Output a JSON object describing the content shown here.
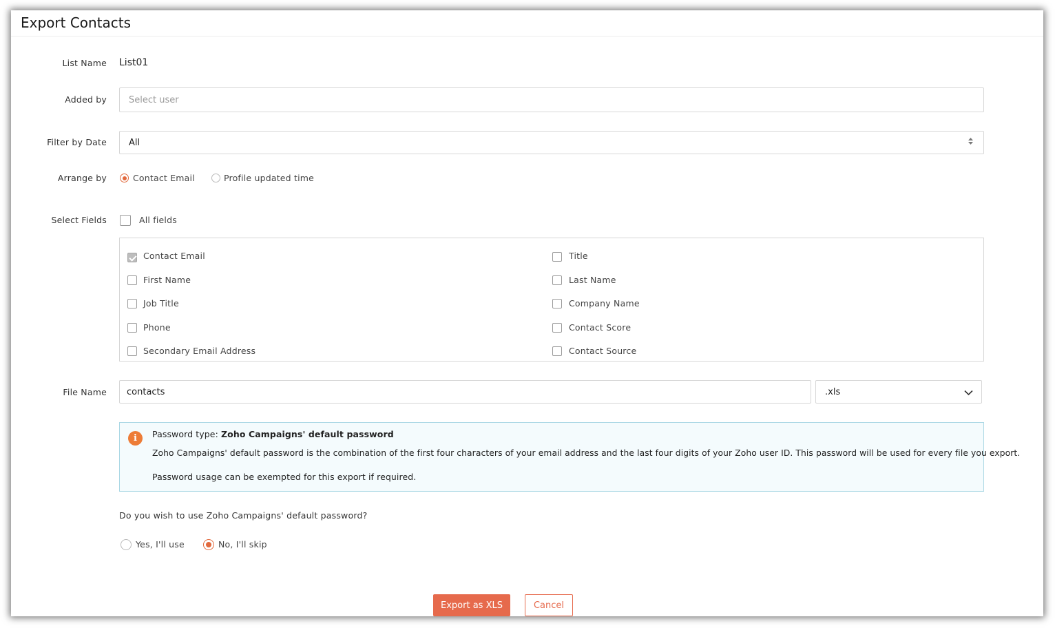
{
  "dialog": {
    "title": "Export Contacts"
  },
  "list_name": {
    "label": "List Name",
    "value": "List01"
  },
  "added_by": {
    "label": "Added by",
    "placeholder": "Select user"
  },
  "filter_by_date": {
    "label": "Filter by Date",
    "value": "All"
  },
  "arrange_by": {
    "label": "Arrange by",
    "options": [
      {
        "label": "Contact Email",
        "selected": true
      },
      {
        "label": "Profile updated time",
        "selected": false
      }
    ]
  },
  "select_fields": {
    "label": "Select Fields",
    "all_fields_label": "All fields",
    "fields": [
      {
        "label": "Contact Email",
        "checked": true
      },
      {
        "label": "Title",
        "checked": false
      },
      {
        "label": "First Name",
        "checked": false
      },
      {
        "label": "Last Name",
        "checked": false
      },
      {
        "label": "Job Title",
        "checked": false
      },
      {
        "label": "Company Name",
        "checked": false
      },
      {
        "label": "Phone",
        "checked": false
      },
      {
        "label": "Contact Score",
        "checked": false
      },
      {
        "label": "Secondary Email Address",
        "checked": false
      },
      {
        "label": "Contact Source",
        "checked": false
      }
    ]
  },
  "file_name": {
    "label": "File Name",
    "value": "contacts",
    "extension": ".xls"
  },
  "info": {
    "type_label": "Password type:",
    "type_value": "Zoho Campaigns' default password",
    "description": "Zoho Campaigns' default password is the combination of the first four characters of your email address and the last four digits of your Zoho user ID. This password will be used for every file you export.",
    "exemption": "Password usage can be exempted for this export if required."
  },
  "password_question": {
    "text": "Do you wish to use Zoho Campaigns' default password?",
    "options": [
      {
        "label": "Yes, I'll use",
        "selected": false
      },
      {
        "label": "No, I'll skip",
        "selected": true
      }
    ]
  },
  "actions": {
    "export_label": "Export as XLS",
    "cancel_label": "Cancel"
  },
  "colors": {
    "accent": "#e66a4c",
    "info_border": "#a9d7e4",
    "info_bg": "#f4fbfd",
    "info_icon": "#ed7c37"
  }
}
